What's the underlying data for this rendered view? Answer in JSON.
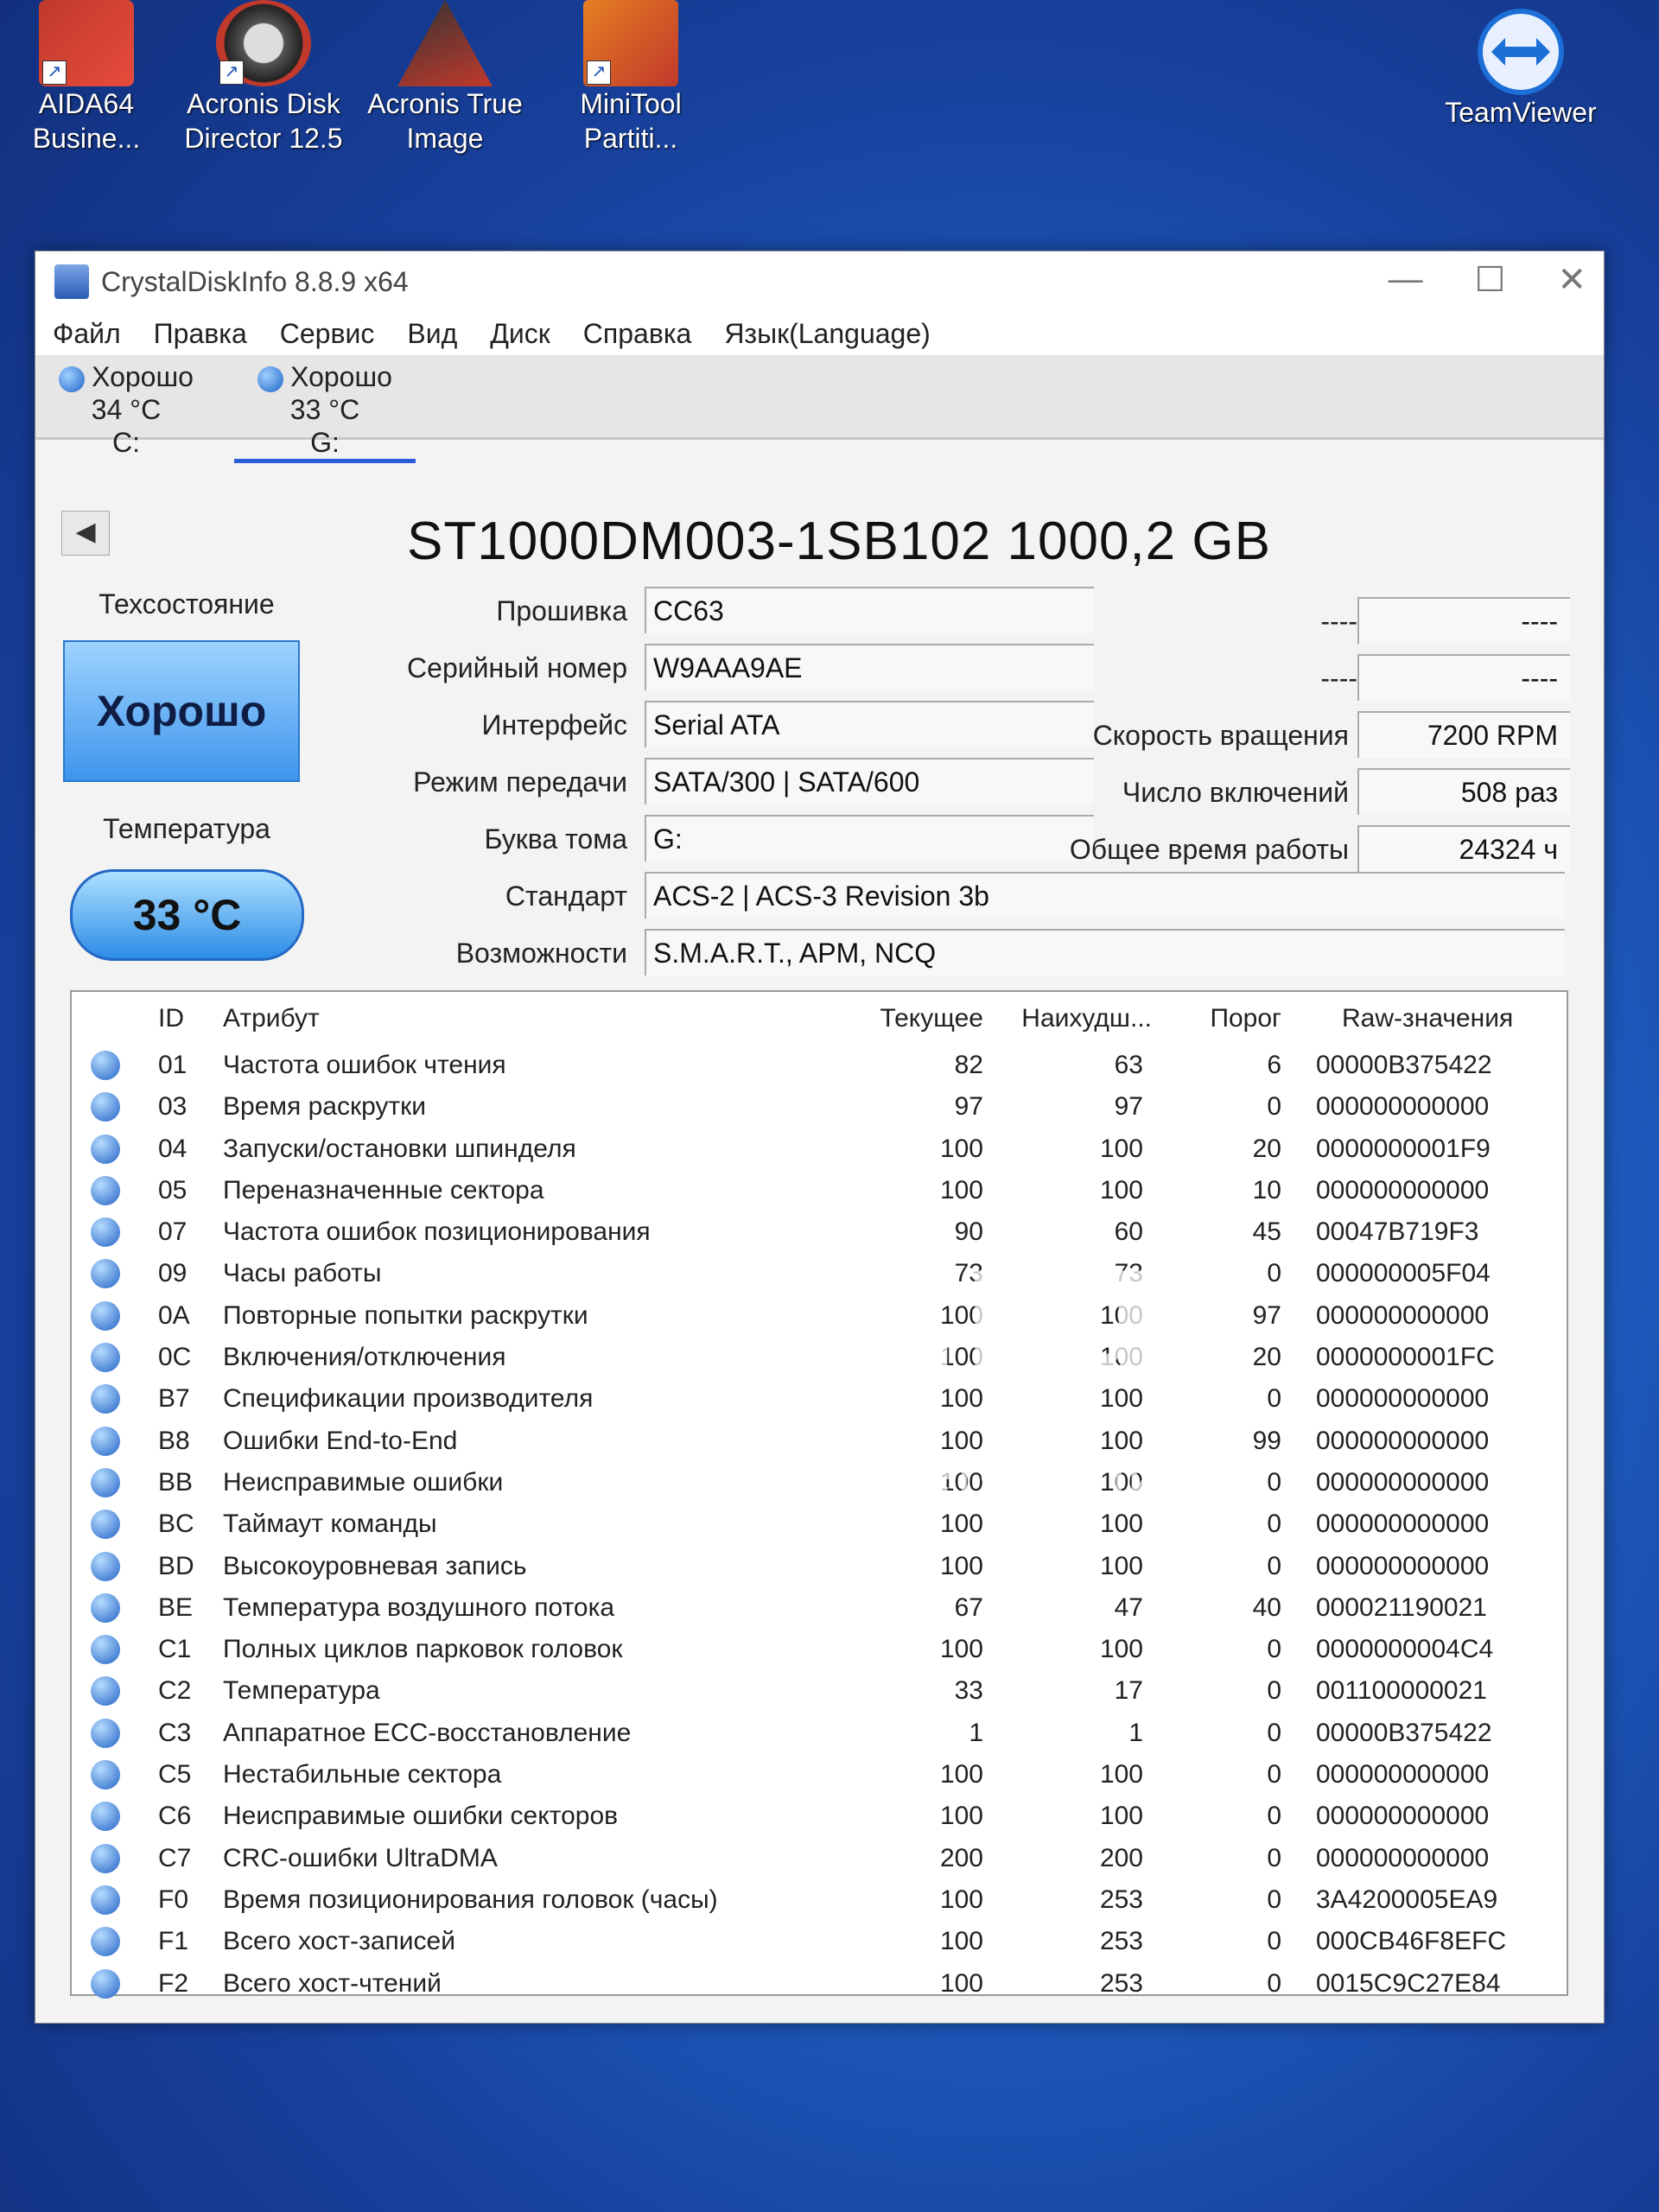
{
  "desktop": {
    "icons": [
      {
        "label_line1": "AIDA64",
        "label_line2": "Busine..."
      },
      {
        "label_line1": "Acronis Disk",
        "label_line2": "Director 12.5"
      },
      {
        "label_line1": "Acronis True",
        "label_line2": "Image"
      },
      {
        "label_line1": "MiniTool",
        "label_line2": "Partiti..."
      },
      {
        "label_line1": "TeamViewer",
        "label_line2": ""
      }
    ]
  },
  "window": {
    "title": "CrystalDiskInfo 8.8.9 x64",
    "controls": {
      "minimize": "—",
      "maximize": "☐",
      "close": "✕"
    }
  },
  "menu": [
    "Файл",
    "Правка",
    "Сервис",
    "Вид",
    "Диск",
    "Справка",
    "Язык(Language)"
  ],
  "drives": [
    {
      "status": "Хорошо",
      "temp": "34 °C",
      "letter": "C:"
    },
    {
      "status": "Хорошо",
      "temp": "33 °C",
      "letter": "G:"
    }
  ],
  "disk": {
    "model": "ST1000DM003-1SB102 1000,2 GB",
    "health_label": "Техсостояние",
    "health_value": "Хорошо",
    "temp_label": "Температура",
    "temp_value": "33 °C",
    "fields": {
      "firmware_label": "Прошивка",
      "firmware": "CC63",
      "serial_label": "Серийный номер",
      "serial": "W9AAA9AE",
      "interface_label": "Интерфейс",
      "interface": "Serial ATA",
      "transfer_label": "Режим передачи",
      "transfer": "SATA/300 | SATA/600",
      "volume_label": "Буква тома",
      "volume": "G:",
      "standard_label": "Стандарт",
      "standard": "ACS-2 | ACS-3 Revision 3b",
      "features_label": "Возможности",
      "features": "S.M.A.R.T., APM, NCQ"
    },
    "right": {
      "blank1_label": "----",
      "blank1": "----",
      "blank2_label": "----",
      "blank2": "----",
      "rpm_label": "Скорость вращения",
      "rpm": "7200 RPM",
      "power_count_label": "Число включений",
      "power_count": "508 раз",
      "hours_label": "Общее время работы",
      "hours": "24324 ч"
    }
  },
  "table": {
    "headers": {
      "id": "ID",
      "attr": "Атрибут",
      "cur": "Текущее",
      "worst": "Наихудш...",
      "thr": "Порог",
      "raw": "Raw-значения"
    },
    "rows": [
      {
        "id": "01",
        "name": "Частота ошибок чтения",
        "cur": "82",
        "worst": "63",
        "thr": "6",
        "raw": "00000B375422"
      },
      {
        "id": "03",
        "name": "Время раскрутки",
        "cur": "97",
        "worst": "97",
        "thr": "0",
        "raw": "000000000000"
      },
      {
        "id": "04",
        "name": "Запуски/остановки шпинделя",
        "cur": "100",
        "worst": "100",
        "thr": "20",
        "raw": "0000000001F9"
      },
      {
        "id": "05",
        "name": "Переназначенные сектора",
        "cur": "100",
        "worst": "100",
        "thr": "10",
        "raw": "000000000000"
      },
      {
        "id": "07",
        "name": "Частота ошибок позиционирования",
        "cur": "90",
        "worst": "60",
        "thr": "45",
        "raw": "00047B719F3"
      },
      {
        "id": "09",
        "name": "Часы работы",
        "cur": "73",
        "worst": "73",
        "thr": "0",
        "raw": "000000005F04"
      },
      {
        "id": "0A",
        "name": "Повторные попытки раскрутки",
        "cur": "100",
        "worst": "100",
        "thr": "97",
        "raw": "000000000000"
      },
      {
        "id": "0C",
        "name": "Включения/отключения",
        "cur": "100",
        "worst": "100",
        "thr": "20",
        "raw": "0000000001FC"
      },
      {
        "id": "B7",
        "name": "Спецификации производителя",
        "cur": "100",
        "worst": "100",
        "thr": "0",
        "raw": "000000000000"
      },
      {
        "id": "B8",
        "name": "Ошибки End-to-End",
        "cur": "100",
        "worst": "100",
        "thr": "99",
        "raw": "000000000000"
      },
      {
        "id": "BB",
        "name": "Неисправимые ошибки",
        "cur": "100",
        "worst": "100",
        "thr": "0",
        "raw": "000000000000"
      },
      {
        "id": "BC",
        "name": "Таймаут команды",
        "cur": "100",
        "worst": "100",
        "thr": "0",
        "raw": "000000000000"
      },
      {
        "id": "BD",
        "name": "Высокоуровневая запись",
        "cur": "100",
        "worst": "100",
        "thr": "0",
        "raw": "000000000000"
      },
      {
        "id": "BE",
        "name": "Температура воздушного потока",
        "cur": "67",
        "worst": "47",
        "thr": "40",
        "raw": "000021190021"
      },
      {
        "id": "C1",
        "name": "Полных циклов парковок головок",
        "cur": "100",
        "worst": "100",
        "thr": "0",
        "raw": "0000000004C4"
      },
      {
        "id": "C2",
        "name": "Температура",
        "cur": "33",
        "worst": "17",
        "thr": "0",
        "raw": "001100000021"
      },
      {
        "id": "C3",
        "name": "Аппаратное ECC-восстановление",
        "cur": "1",
        "worst": "1",
        "thr": "0",
        "raw": "00000B375422"
      },
      {
        "id": "C5",
        "name": "Нестабильные сектора",
        "cur": "100",
        "worst": "100",
        "thr": "0",
        "raw": "000000000000"
      },
      {
        "id": "C6",
        "name": "Неисправимые ошибки секторов",
        "cur": "100",
        "worst": "100",
        "thr": "0",
        "raw": "000000000000"
      },
      {
        "id": "C7",
        "name": "CRC-ошибки UltraDMA",
        "cur": "200",
        "worst": "200",
        "thr": "0",
        "raw": "000000000000"
      },
      {
        "id": "F0",
        "name": "Время позиционирования головок (часы)",
        "cur": "100",
        "worst": "253",
        "thr": "0",
        "raw": "3A4200005EA9"
      },
      {
        "id": "F1",
        "name": "Всего хост-записей",
        "cur": "100",
        "worst": "253",
        "thr": "0",
        "raw": "000CB46F8EFC"
      },
      {
        "id": "F2",
        "name": "Всего хост-чтений",
        "cur": "100",
        "worst": "253",
        "thr": "0",
        "raw": "0015C9C27E84"
      }
    ]
  },
  "watermark": {
    "main": "au.ru",
    "sub": "интернет-аукцион"
  }
}
